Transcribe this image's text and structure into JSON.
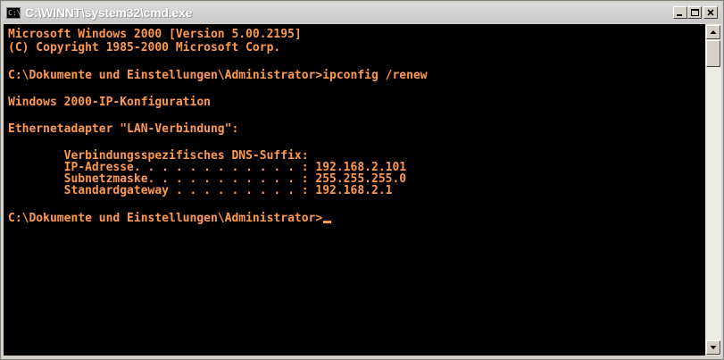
{
  "window": {
    "title": "C:\\WINNT\\system32\\cmd.exe",
    "icon": "command-prompt-icon",
    "controls": {
      "minimize_icon": "minimize-icon",
      "maximize_icon": "maximize-icon",
      "close_icon": "close-icon"
    }
  },
  "console": {
    "text_color": "#ff9a4d",
    "background": "#000000",
    "lines": [
      "Microsoft Windows 2000 [Version 5.00.2195]",
      "(C) Copyright 1985-2000 Microsoft Corp.",
      "",
      "C:\\Dokumente und Einstellungen\\Administrator>ipconfig /renew",
      "",
      "Windows 2000-IP-Konfiguration",
      "",
      "Ethernetadapter \"LAN-Verbindung\":",
      "",
      "        Verbindungsspezifisches DNS-Suffix:",
      "        IP-Adresse. . . . . . . . . . . . : 192.168.2.101",
      "        Subnetzmaske. . . . . . . . . . . : 255.255.255.0",
      "        Standardgateway . . . . . . . . . : 192.168.2.1",
      "",
      "C:\\Dokumente und Einstellungen\\Administrator>"
    ]
  },
  "scrollbar": {
    "up_icon": "arrow-up-icon",
    "down_icon": "arrow-down-icon"
  }
}
